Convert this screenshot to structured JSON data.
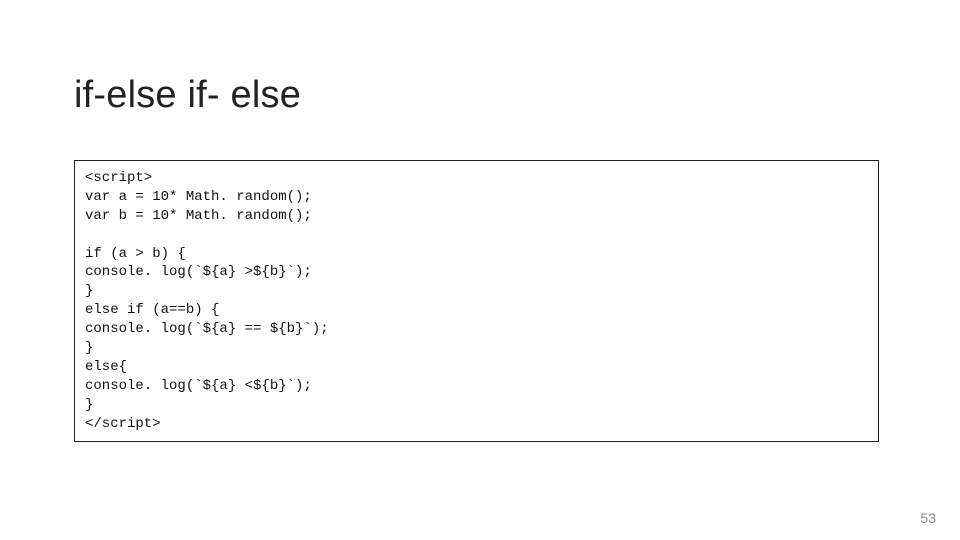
{
  "slide": {
    "title": "if-else if- else",
    "code": "<script>\nvar a = 10* Math. random();\nvar b = 10* Math. random();\n\nif (a > b) {\nconsole. log(`${a} >${b}`);\n}\nelse if (a==b) {\nconsole. log(`${a} == ${b}`);\n}\nelse{\nconsole. log(`${a} <${b}`);\n}\n</script>",
    "page_number": "53"
  }
}
